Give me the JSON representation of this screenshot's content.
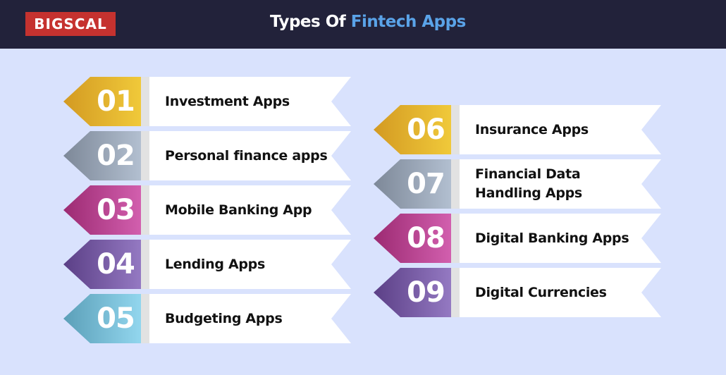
{
  "header": {
    "logo_text": "BIGSCAL",
    "title_prefix": "Types Of ",
    "title_accent": "Fintech Apps",
    "background_color": "#22223a",
    "logo_color": "#c5322f",
    "accent_color": "#5aa3e8"
  },
  "background_color": "#d9e2fd",
  "items": [
    {
      "number": "01",
      "label": "Investment Apps",
      "color_start": "#d39a22",
      "color_end": "#f0c93a"
    },
    {
      "number": "02",
      "label": "Personal finance apps",
      "color_start": "#7d8898",
      "color_end": "#b2bfd0"
    },
    {
      "number": "03",
      "label": "Mobile Banking App",
      "color_start": "#9c2a72",
      "color_end": "#d25fae"
    },
    {
      "number": "04",
      "label": "Lending Apps",
      "color_start": "#5b3f86",
      "color_end": "#9479c2"
    },
    {
      "number": "05",
      "label": "Budgeting Apps",
      "color_start": "#5b9fb8",
      "color_end": "#92d6ee"
    },
    {
      "number": "06",
      "label": "Insurance Apps",
      "color_start": "#d39a22",
      "color_end": "#f0c93a"
    },
    {
      "number": "07",
      "label": "Financial Data Handling Apps",
      "color_start": "#7d8898",
      "color_end": "#b2bfd0"
    },
    {
      "number": "08",
      "label": "Digital Banking Apps",
      "color_start": "#9c2a72",
      "color_end": "#d25fae"
    },
    {
      "number": "09",
      "label": "Digital Currencies",
      "color_start": "#5b3f86",
      "color_end": "#9479c2"
    }
  ]
}
